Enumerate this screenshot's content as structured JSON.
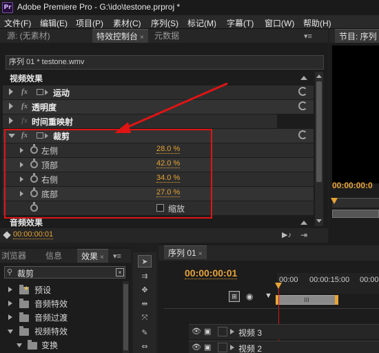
{
  "titlebar": {
    "title": "Adobe Premiere Pro - G:\\ido\\testone.prproj *",
    "icon": "Pr"
  },
  "menu": [
    "文件(F)",
    "编辑(E)",
    "项目(P)",
    "素材(C)",
    "序列(S)",
    "标记(M)",
    "字幕(T)",
    "窗口(W)",
    "帮助(H)"
  ],
  "source_panel": {
    "tabs": [
      "源: (无素材)",
      "特效控制台",
      "元数据"
    ],
    "tab_close": "×",
    "sequence_clip": "序列 01 * testone.wmv",
    "video_effects_label": "视频效果",
    "effects": [
      {
        "label": "运动",
        "expanded": false
      },
      {
        "label": "透明度",
        "expanded": false
      },
      {
        "label": "时间重映射",
        "expanded": false,
        "dimmed": true
      },
      {
        "label": "裁剪",
        "expanded": true
      }
    ],
    "crop_params": [
      {
        "label": "左侧",
        "value": "28.0 %"
      },
      {
        "label": "顶部",
        "value": "42.0 %"
      },
      {
        "label": "右侧",
        "value": "34.0 %"
      },
      {
        "label": "底部",
        "value": "27.0 %"
      }
    ],
    "zoom_checkbox_label": "缩放",
    "audio_effects_label": "音频效果",
    "timecode": "00:00:00:01",
    "fx_label": "fx"
  },
  "program_panel": {
    "tab": "节目: 序列",
    "timecode": "00:00:00:0"
  },
  "browser_panel": {
    "tabs": [
      "浏览器",
      "信息",
      "效果"
    ],
    "search_value": "裁剪",
    "tree": [
      {
        "label": "预设",
        "level": 0,
        "expanded": false,
        "star": true
      },
      {
        "label": "音频特效",
        "level": 0,
        "expanded": false
      },
      {
        "label": "音频过渡",
        "level": 0,
        "expanded": false
      },
      {
        "label": "视频特效",
        "level": 0,
        "expanded": true
      },
      {
        "label": "变换",
        "level": 1,
        "expanded": true
      }
    ]
  },
  "timeline_panel": {
    "tab": "序列 01",
    "timecode": "00:00:00:01",
    "ruler": [
      "00:00",
      "00:00:15:00",
      "00:00"
    ],
    "tracks": [
      "视频 3",
      "视频 2"
    ],
    "clip_label": "III"
  },
  "colors": {
    "accent_orange": "#e8a534",
    "annotation_red": "#e01414"
  }
}
